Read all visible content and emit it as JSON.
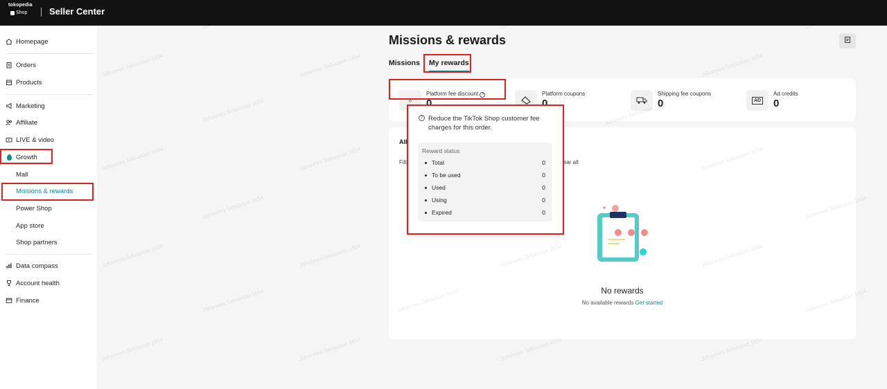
{
  "topbar": {
    "logo_line1": "tokopedia",
    "logo_line2": "Shop",
    "title": "Seller Center"
  },
  "sidebar": {
    "items": [
      {
        "label": "Homepage",
        "icon": "home-icon"
      },
      {
        "label": "Orders",
        "icon": "clipboard-icon"
      },
      {
        "label": "Products",
        "icon": "box-icon"
      },
      {
        "label": "Marketing",
        "icon": "megaphone-icon"
      },
      {
        "label": "Affiliate",
        "icon": "people-icon"
      },
      {
        "label": "LIVE & video",
        "icon": "video-icon"
      },
      {
        "label": "Growth",
        "icon": "growth-icon"
      },
      {
        "label": "Mall"
      },
      {
        "label": "Missions & rewards"
      },
      {
        "label": "Power Shop"
      },
      {
        "label": "App store"
      },
      {
        "label": "Shop partners"
      },
      {
        "label": "Data compass",
        "icon": "chart-icon"
      },
      {
        "label": "Account health",
        "icon": "trophy-icon"
      },
      {
        "label": "Finance",
        "icon": "wallet-icon"
      }
    ]
  },
  "main": {
    "title": "Missions & rewards",
    "tabs": [
      {
        "label": "Missions"
      },
      {
        "label": "My rewards"
      }
    ],
    "rewards": [
      {
        "label": "Platform fee discount",
        "value": "0",
        "icon": "discount-bag-icon"
      },
      {
        "label": "Platform coupons",
        "value": "0",
        "icon": "coupon-icon"
      },
      {
        "label": "Shipping fee coupons",
        "value": "0",
        "icon": "truck-icon"
      },
      {
        "label": "Ad credits",
        "value": "0",
        "icon": "ad-icon"
      }
    ],
    "list_tab": "All",
    "filter_label": "Filt",
    "clear_label": "ear all",
    "empty": {
      "title": "No rewards",
      "subtitle": "No available rewards",
      "link": "Get started"
    }
  },
  "tooltip": {
    "text": "Reduce the TikTok Shop customer fee charges for this order.",
    "status_header": "Reward status",
    "rows": [
      {
        "name": "Total",
        "value": "0"
      },
      {
        "name": "To be used",
        "value": "0"
      },
      {
        "name": "Used",
        "value": "0"
      },
      {
        "name": "Using",
        "value": "0"
      },
      {
        "name": "Expired",
        "value": "0"
      }
    ]
  },
  "watermark": "Johannes Sebastian 1654",
  "colors": {
    "accent": "#0f8b8d",
    "topbar": "#121212",
    "annotation": "#e02020"
  }
}
